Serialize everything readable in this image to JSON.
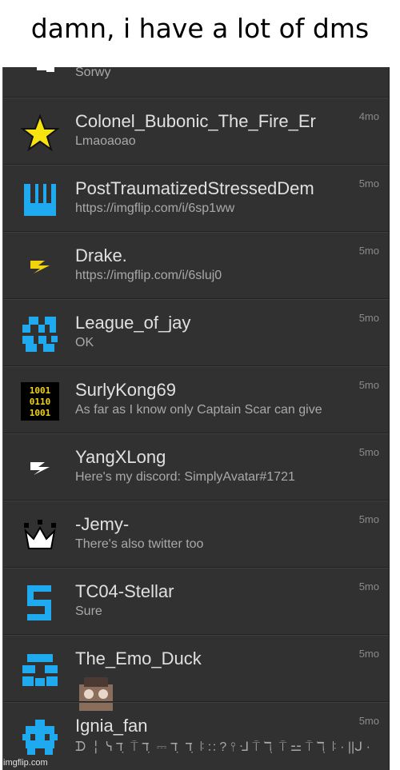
{
  "caption": "damn, i have a lot of dms",
  "watermark": "imgflip.com",
  "colors": {
    "panel_bg": "#313131",
    "accent_blue": "#1faaf0",
    "star_yellow": "#f6e30f",
    "icon_white": "#ffffff"
  },
  "conversations": [
    {
      "name": "",
      "message": "Sorwy",
      "time": "",
      "avatar": "partial-avatar-icon"
    },
    {
      "name": "Colonel_Bubonic_The_Fire_Er",
      "message": "Lmaoaoao",
      "time": "4mo",
      "avatar": "star-icon"
    },
    {
      "name": "PostTraumatizedStressedDem",
      "message": "https://imgflip.com/i/6sp1ww",
      "time": "5mo",
      "avatar": "blue-block-avatar-icon"
    },
    {
      "name": "Drake.",
      "message": "https://imgflip.com/i/6sluj0",
      "time": "5mo",
      "avatar": "yellow-bolt-icon"
    },
    {
      "name": "League_of_jay",
      "message": "OK",
      "time": "5mo",
      "avatar": "blue-pixel-avatar-icon"
    },
    {
      "name": "SurlyKong69",
      "message": "As far as I know only Captain Scar can give",
      "time": "5mo",
      "avatar": "binary-avatar-icon"
    },
    {
      "name": "YangXLong",
      "message": "Here's my discord: SimplyAvatar#1721",
      "time": "5mo",
      "avatar": "white-bolt-icon"
    },
    {
      "name": "-Jemy-",
      "message": "There's also twitter too",
      "time": "5mo",
      "avatar": "crown-icon"
    },
    {
      "name": "TC04-Stellar",
      "message": "Sure",
      "time": "5mo",
      "avatar": "blue-s-avatar-icon"
    },
    {
      "name": "The_Emo_Duck",
      "message": "",
      "time": "5mo",
      "avatar": "blue-pixel-face-icon"
    },
    {
      "name": "Ignia_fan",
      "message": "ᗪ ╎ ᓭ ℸ ̣ ⍑ ℸ ̣ ⎓ ℸ ̣ ℸ ̣ ꖎ ∷ ? ⫯ ᒲ ⍑ ℸ ̣ ⍑ ⚍ ⍑ ℸ ̣ ꖎ · ||ᒍ ·",
      "time": "5mo",
      "avatar": "blue-pixel-bug-icon"
    }
  ]
}
